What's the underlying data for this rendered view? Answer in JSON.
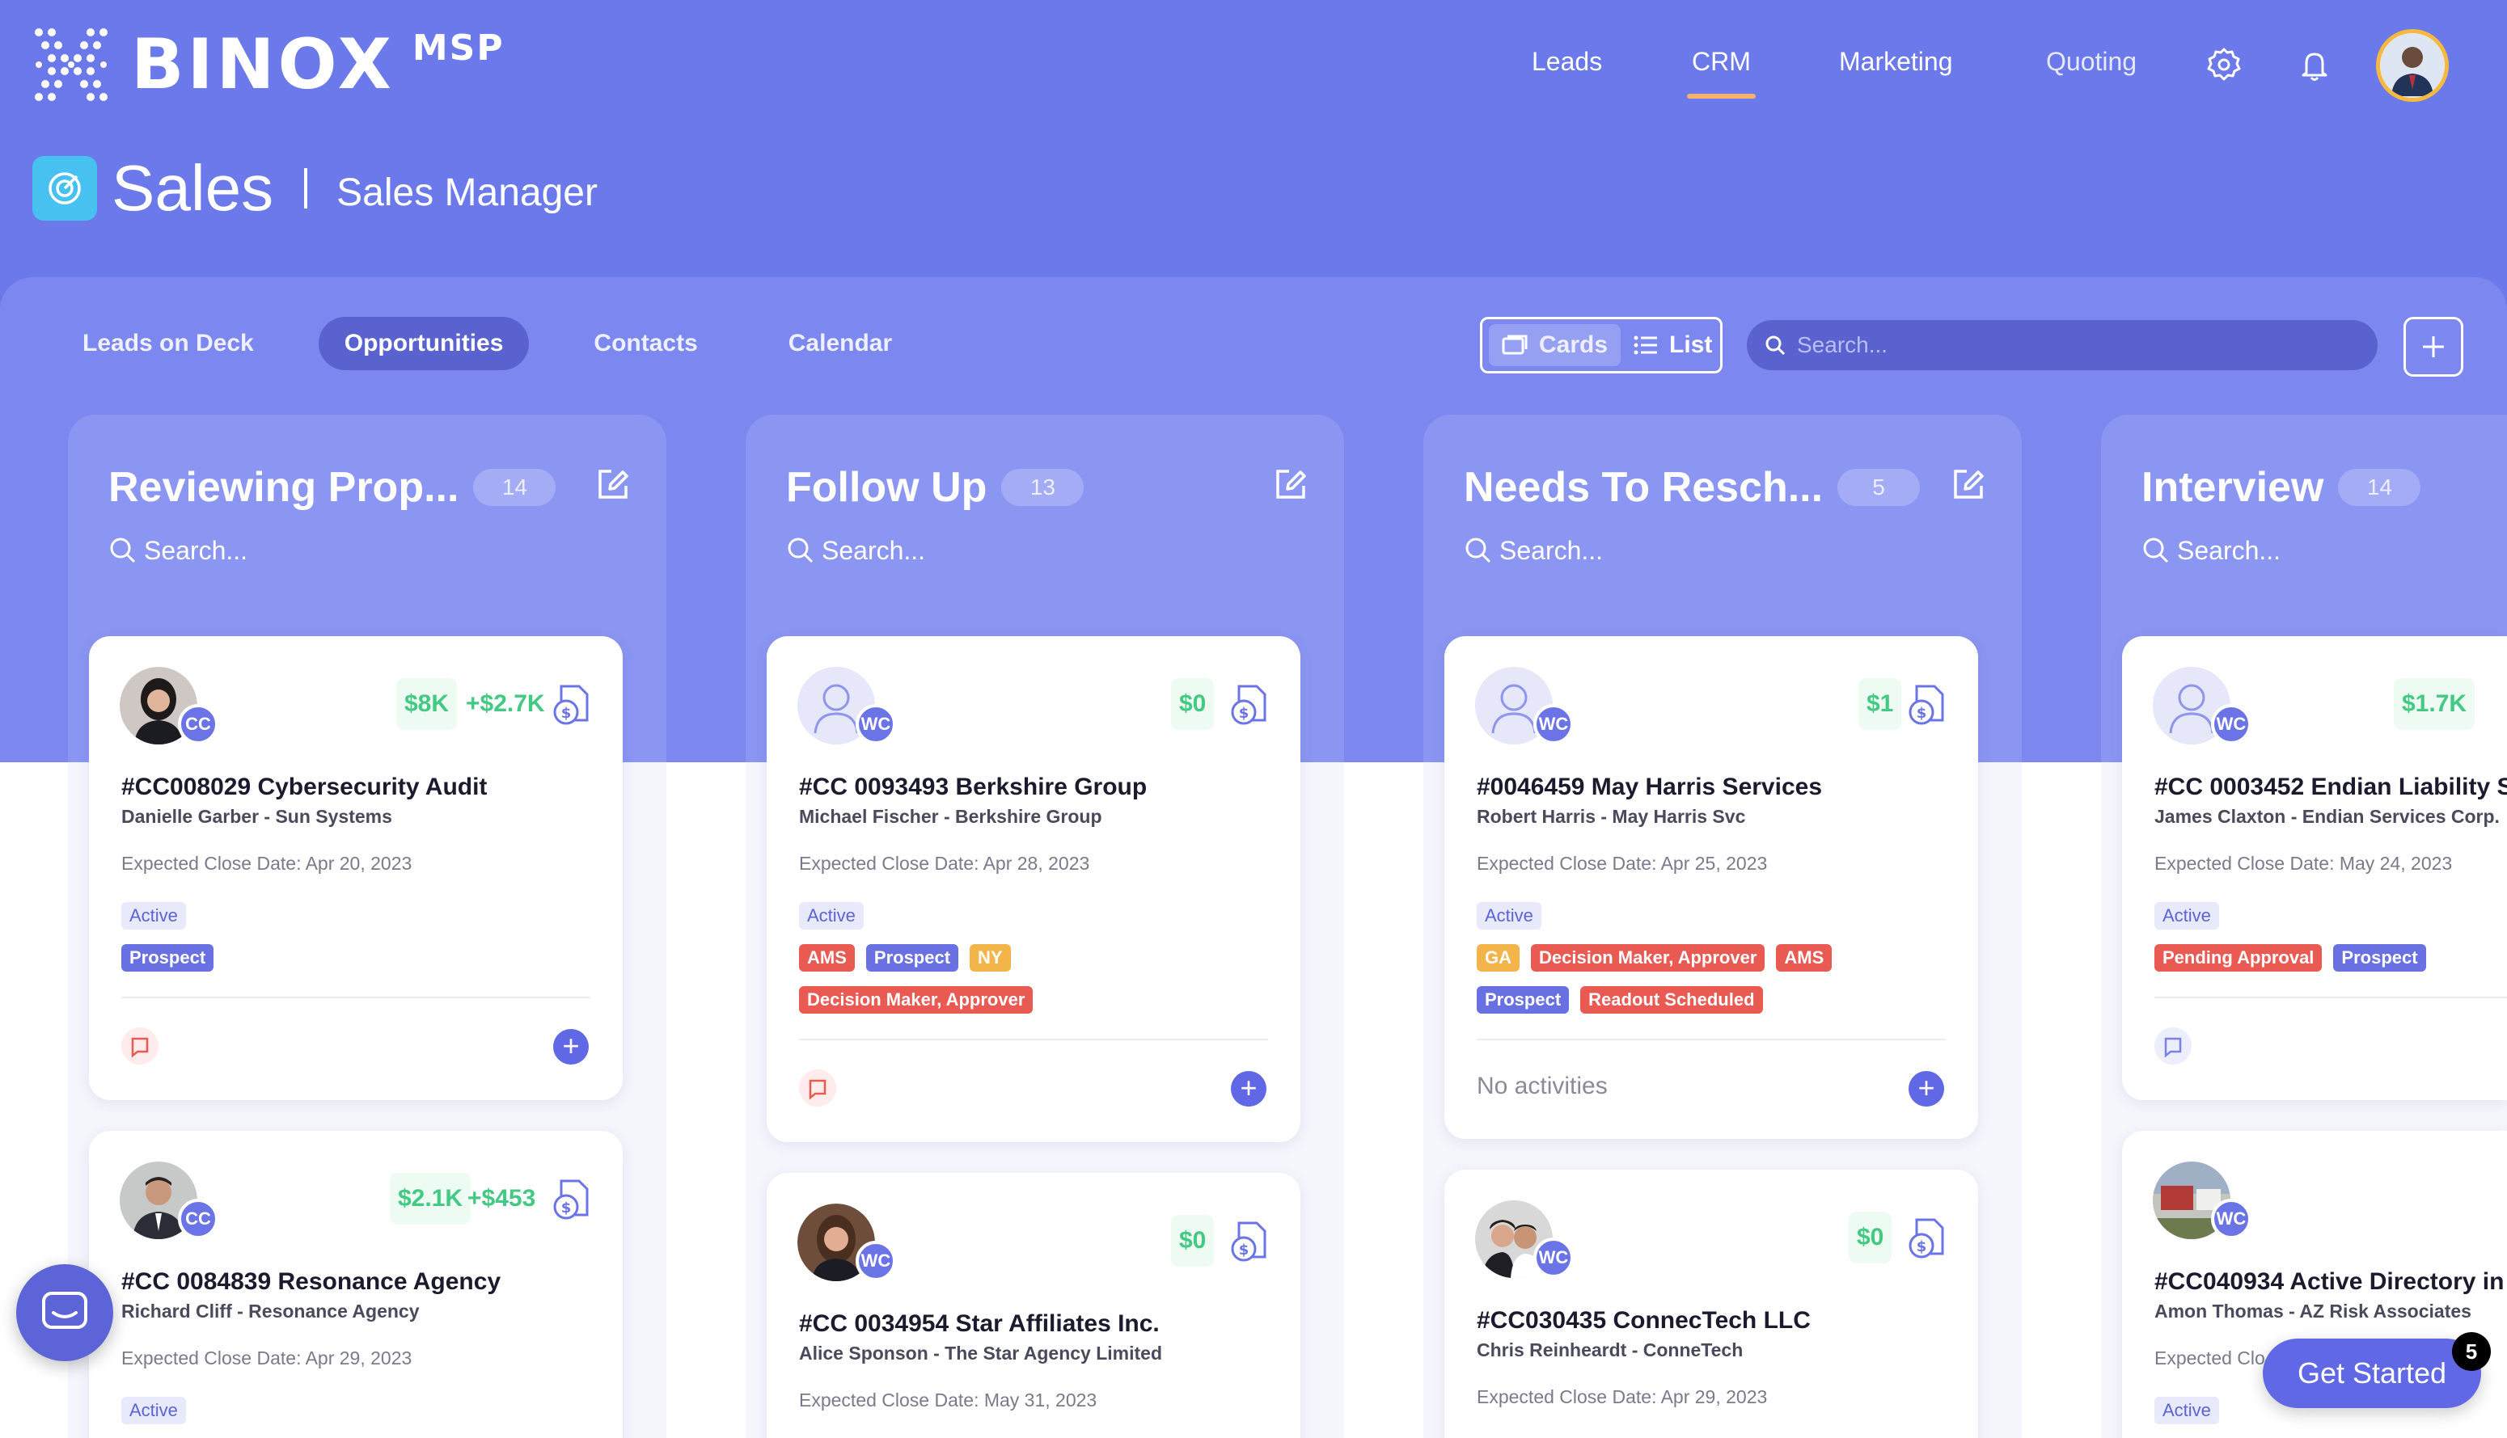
{
  "brand": {
    "name": "BINOX",
    "suffix": "MSP"
  },
  "nav": {
    "links": [
      "Leads",
      "CRM",
      "Marketing",
      "Quoting"
    ],
    "active": "CRM",
    "colors": {
      "accent": "#f6b26b",
      "hero": "#6b79ea"
    }
  },
  "page": {
    "title": "Sales",
    "subtitle": "Sales Manager"
  },
  "tabs": [
    "Leads on Deck",
    "Opportunities",
    "Contacts",
    "Calendar"
  ],
  "active_tab": "Opportunities",
  "view": {
    "cards": "Cards",
    "list": "List"
  },
  "search": {
    "placeholder": "Search..."
  },
  "columns": [
    {
      "title": "Reviewing Prop...",
      "count": "14",
      "search_placeholder": "Search...",
      "cards": [
        {
          "initials": "CC",
          "amount": "$8K",
          "extra": "+$2.7K",
          "title": "#CC008029 Cybersecurity Audit",
          "sub": "Danielle Garber - Sun Systems",
          "date": "Expected Close Date: Apr 20, 2023",
          "tags": [
            [
              "Active"
            ],
            [
              "Prospect"
            ]
          ],
          "activity": ""
        },
        {
          "initials": "CC",
          "amount": "$2.1K",
          "extra": "+$453",
          "title": "#CC 0084839 Resonance Agency",
          "sub": "Richard Cliff - Resonance Agency",
          "date": "Expected Close Date: Apr 29, 2023",
          "tags": [
            [
              "Active"
            ]
          ],
          "activity": ""
        }
      ]
    },
    {
      "title": "Follow Up",
      "count": "13",
      "search_placeholder": "Search...",
      "cards": [
        {
          "initials": "WC",
          "amount": "$0",
          "extra": "",
          "title": "#CC 0093493 Berkshire Group",
          "sub": "Michael Fischer - Berkshire Group",
          "date": "Expected Close Date: Apr 28, 2023",
          "tags": [
            [
              "Active"
            ],
            [
              "AMS",
              "Prospect",
              "NY"
            ],
            [
              "Decision Maker, Approver"
            ]
          ],
          "activity": ""
        },
        {
          "initials": "WC",
          "amount": "$0",
          "extra": "",
          "title": "#CC 0034954 Star Affiliates Inc.",
          "sub": "Alice Sponson - The Star Agency Limited",
          "date": "Expected Close Date: May 31, 2023",
          "tags": [],
          "activity": ""
        }
      ]
    },
    {
      "title": "Needs To Resch...",
      "count": "5",
      "search_placeholder": "Search...",
      "cards": [
        {
          "initials": "WC",
          "amount": "$1",
          "extra": "",
          "title": "#0046459 May Harris Services",
          "sub": "Robert Harris - May Harris Svc",
          "date": "Expected Close Date: Apr 25, 2023",
          "tags": [
            [
              "Active"
            ],
            [
              "GA",
              "Decision Maker, Approver",
              "AMS"
            ],
            [
              "Prospect",
              "Readout Scheduled"
            ]
          ],
          "activity": "No activities"
        },
        {
          "initials": "WC",
          "amount": "$0",
          "extra": "",
          "title": "#CC030435 ConnecTech LLC",
          "sub": "Chris Reinheardt - ConneTech",
          "date": "Expected Close Date: Apr 29, 2023",
          "tags": [],
          "activity": ""
        }
      ]
    },
    {
      "title": "Interview",
      "count": "14",
      "search_placeholder": "Search...",
      "cards": [
        {
          "initials": "WC",
          "amount": "$1.7K",
          "extra": "",
          "title": "#CC 0003452 Endian Liability S",
          "sub": "James Claxton - Endian Services Corp.",
          "date": "Expected Close Date: May 24, 2023",
          "tags": [
            [
              "Active"
            ],
            [
              "Pending Approval",
              "Prospect"
            ]
          ],
          "activity": ""
        },
        {
          "initials": "WC",
          "amount": "",
          "extra": "",
          "title": "#CC040934 Active Directory in",
          "sub": "Amon Thomas - AZ Risk Associates",
          "date": "Expected Clo",
          "tags": [
            [
              "Active"
            ]
          ],
          "activity": ""
        }
      ]
    }
  ],
  "get_started": {
    "label": "Get Started",
    "badge": "5"
  }
}
